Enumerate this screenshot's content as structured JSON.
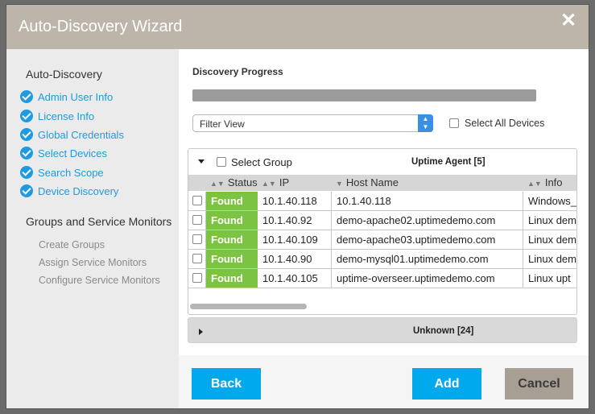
{
  "window": {
    "title": "Auto-Discovery Wizard"
  },
  "sidebar": {
    "section1": "Auto-Discovery",
    "steps": [
      {
        "label": "Admin User Info"
      },
      {
        "label": "License Info"
      },
      {
        "label": "Global Credentials"
      },
      {
        "label": "Select Devices"
      },
      {
        "label": "Search Scope"
      },
      {
        "label": "Device Discovery"
      }
    ],
    "section2": "Groups and Service Monitors",
    "substeps": [
      {
        "label": "Create Groups"
      },
      {
        "label": "Assign Service Monitors"
      },
      {
        "label": "Configure Service Monitors"
      }
    ]
  },
  "main": {
    "progress_title": "Discovery Progress",
    "filter": {
      "value": "Filter View"
    },
    "select_all_label": "Select All Devices",
    "group": {
      "select_label": "Select Group",
      "name": "Uptime Agent [5]",
      "columns": [
        "Status",
        "IP",
        "Host Name",
        "Info"
      ],
      "rows": [
        {
          "status": "Found",
          "ip": "10.1.40.118",
          "host": "10.1.40.118",
          "info": "Windows_"
        },
        {
          "status": "Found",
          "ip": "10.1.40.92",
          "host": "demo-apache02.uptimedemo.com",
          "info": "Linux dem"
        },
        {
          "status": "Found",
          "ip": "10.1.40.109",
          "host": "demo-apache03.uptimedemo.com",
          "info": "Linux dem"
        },
        {
          "status": "Found",
          "ip": "10.1.40.90",
          "host": "demo-mysql01.uptimedemo.com",
          "info": "Linux dem"
        },
        {
          "status": "Found",
          "ip": "10.1.40.105",
          "host": "uptime-overseer.uptimedemo.com",
          "info": "Linux upt"
        }
      ]
    },
    "unknown_group": "Unknown [24]"
  },
  "buttons": {
    "back": "Back",
    "add": "Add",
    "cancel": "Cancel"
  },
  "colors": {
    "accent": "#00a8ec",
    "found": "#7cc243",
    "titlebar": "#bdb5aa",
    "cancel": "#a89f94"
  }
}
